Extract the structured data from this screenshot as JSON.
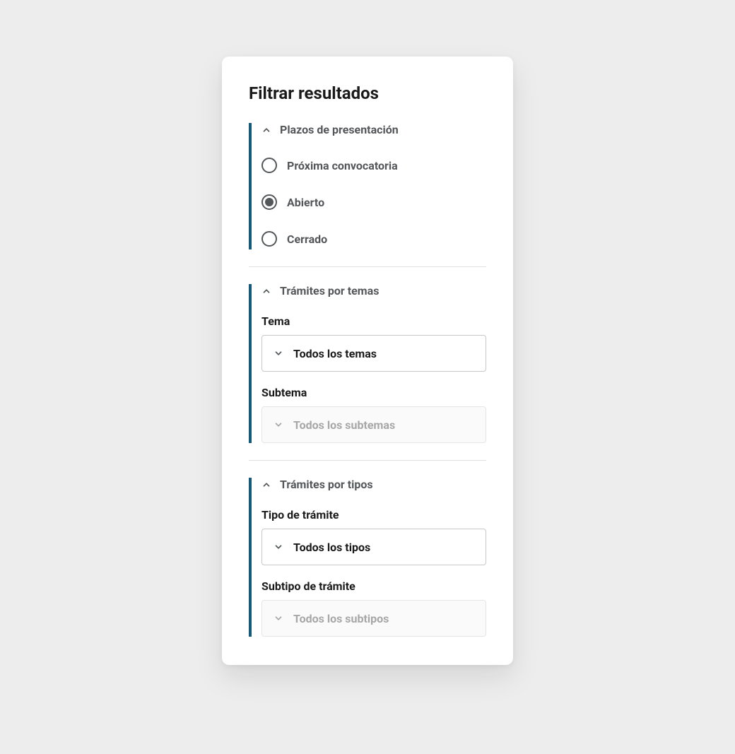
{
  "title": "Filtrar resultados",
  "sections": {
    "plazos": {
      "header": "Plazos de presentación",
      "options": [
        {
          "label": "Próxima convocatoria",
          "checked": false
        },
        {
          "label": "Abierto",
          "checked": true
        },
        {
          "label": "Cerrado",
          "checked": false
        }
      ]
    },
    "temas": {
      "header": "Trámites por temas",
      "tema": {
        "label": "Tema",
        "value": "Todos los temas",
        "disabled": false
      },
      "subtema": {
        "label": "Subtema",
        "value": "Todos los subtemas",
        "disabled": true
      }
    },
    "tipos": {
      "header": "Trámites por tipos",
      "tipo": {
        "label": "Tipo de trámite",
        "value": "Todos los tipos",
        "disabled": false
      },
      "subtipo": {
        "label": "Subtipo de trámite",
        "value": "Todos los subtipos",
        "disabled": true
      }
    }
  }
}
